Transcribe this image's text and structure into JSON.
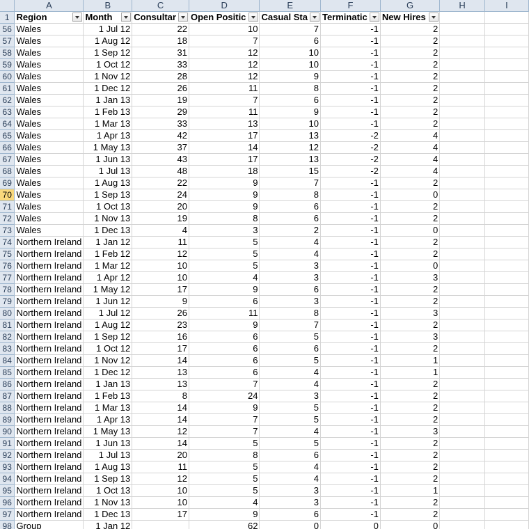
{
  "column_letters": [
    "A",
    "B",
    "C",
    "D",
    "E",
    "F",
    "G",
    "H",
    "I"
  ],
  "header_row": {
    "row_number": "1",
    "cells": [
      "Region",
      "Month",
      "Consultar",
      "Open Positic",
      "Casual Sta",
      "Terminatic",
      "New Hires"
    ]
  },
  "active_row": "70",
  "rows": [
    {
      "n": "56",
      "c": [
        "Wales",
        "1 Jul 12",
        "22",
        "10",
        "7",
        "-1",
        "2"
      ]
    },
    {
      "n": "57",
      "c": [
        "Wales",
        "1 Aug 12",
        "18",
        "7",
        "6",
        "-1",
        "2"
      ]
    },
    {
      "n": "58",
      "c": [
        "Wales",
        "1 Sep 12",
        "31",
        "12",
        "10",
        "-1",
        "2"
      ]
    },
    {
      "n": "59",
      "c": [
        "Wales",
        "1 Oct 12",
        "33",
        "12",
        "10",
        "-1",
        "2"
      ]
    },
    {
      "n": "60",
      "c": [
        "Wales",
        "1 Nov 12",
        "28",
        "12",
        "9",
        "-1",
        "2"
      ]
    },
    {
      "n": "61",
      "c": [
        "Wales",
        "1 Dec 12",
        "26",
        "11",
        "8",
        "-1",
        "2"
      ]
    },
    {
      "n": "62",
      "c": [
        "Wales",
        "1 Jan 13",
        "19",
        "7",
        "6",
        "-1",
        "2"
      ]
    },
    {
      "n": "63",
      "c": [
        "Wales",
        "1 Feb 13",
        "29",
        "11",
        "9",
        "-1",
        "2"
      ]
    },
    {
      "n": "64",
      "c": [
        "Wales",
        "1 Mar 13",
        "33",
        "13",
        "10",
        "-1",
        "2"
      ]
    },
    {
      "n": "65",
      "c": [
        "Wales",
        "1 Apr 13",
        "42",
        "17",
        "13",
        "-2",
        "4"
      ]
    },
    {
      "n": "66",
      "c": [
        "Wales",
        "1 May 13",
        "37",
        "14",
        "12",
        "-2",
        "4"
      ]
    },
    {
      "n": "67",
      "c": [
        "Wales",
        "1 Jun 13",
        "43",
        "17",
        "13",
        "-2",
        "4"
      ]
    },
    {
      "n": "68",
      "c": [
        "Wales",
        "1 Jul 13",
        "48",
        "18",
        "15",
        "-2",
        "4"
      ]
    },
    {
      "n": "69",
      "c": [
        "Wales",
        "1 Aug 13",
        "22",
        "9",
        "7",
        "-1",
        "2"
      ]
    },
    {
      "n": "70",
      "c": [
        "Wales",
        "1 Sep 13",
        "24",
        "9",
        "8",
        "-1",
        "0"
      ]
    },
    {
      "n": "71",
      "c": [
        "Wales",
        "1 Oct 13",
        "20",
        "9",
        "6",
        "-1",
        "2"
      ]
    },
    {
      "n": "72",
      "c": [
        "Wales",
        "1 Nov 13",
        "19",
        "8",
        "6",
        "-1",
        "2"
      ]
    },
    {
      "n": "73",
      "c": [
        "Wales",
        "1 Dec 13",
        "4",
        "3",
        "2",
        "-1",
        "0"
      ]
    },
    {
      "n": "74",
      "c": [
        "Northern Ireland",
        "1 Jan 12",
        "11",
        "5",
        "4",
        "-1",
        "2"
      ]
    },
    {
      "n": "75",
      "c": [
        "Northern Ireland",
        "1 Feb 12",
        "12",
        "5",
        "4",
        "-1",
        "2"
      ]
    },
    {
      "n": "76",
      "c": [
        "Northern Ireland",
        "1 Mar 12",
        "10",
        "5",
        "3",
        "-1",
        "0"
      ]
    },
    {
      "n": "77",
      "c": [
        "Northern Ireland",
        "1 Apr 12",
        "10",
        "4",
        "3",
        "-1",
        "3"
      ]
    },
    {
      "n": "78",
      "c": [
        "Northern Ireland",
        "1 May 12",
        "17",
        "9",
        "6",
        "-1",
        "2"
      ]
    },
    {
      "n": "79",
      "c": [
        "Northern Ireland",
        "1 Jun 12",
        "9",
        "6",
        "3",
        "-1",
        "2"
      ]
    },
    {
      "n": "80",
      "c": [
        "Northern Ireland",
        "1 Jul 12",
        "26",
        "11",
        "8",
        "-1",
        "3"
      ]
    },
    {
      "n": "81",
      "c": [
        "Northern Ireland",
        "1 Aug 12",
        "23",
        "9",
        "7",
        "-1",
        "2"
      ]
    },
    {
      "n": "82",
      "c": [
        "Northern Ireland",
        "1 Sep 12",
        "16",
        "6",
        "5",
        "-1",
        "3"
      ]
    },
    {
      "n": "83",
      "c": [
        "Northern Ireland",
        "1 Oct 12",
        "17",
        "6",
        "6",
        "-1",
        "2"
      ]
    },
    {
      "n": "84",
      "c": [
        "Northern Ireland",
        "1 Nov 12",
        "14",
        "6",
        "5",
        "-1",
        "1"
      ]
    },
    {
      "n": "85",
      "c": [
        "Northern Ireland",
        "1 Dec 12",
        "13",
        "6",
        "4",
        "-1",
        "1"
      ]
    },
    {
      "n": "86",
      "c": [
        "Northern Ireland",
        "1 Jan 13",
        "13",
        "7",
        "4",
        "-1",
        "2"
      ]
    },
    {
      "n": "87",
      "c": [
        "Northern Ireland",
        "1 Feb 13",
        "8",
        "24",
        "3",
        "-1",
        "2"
      ]
    },
    {
      "n": "88",
      "c": [
        "Northern Ireland",
        "1 Mar 13",
        "14",
        "9",
        "5",
        "-1",
        "2"
      ]
    },
    {
      "n": "89",
      "c": [
        "Northern Ireland",
        "1 Apr 13",
        "14",
        "7",
        "5",
        "-1",
        "2"
      ]
    },
    {
      "n": "90",
      "c": [
        "Northern Ireland",
        "1 May 13",
        "12",
        "7",
        "4",
        "-1",
        "3"
      ]
    },
    {
      "n": "91",
      "c": [
        "Northern Ireland",
        "1 Jun 13",
        "14",
        "5",
        "5",
        "-1",
        "2"
      ]
    },
    {
      "n": "92",
      "c": [
        "Northern Ireland",
        "1 Jul 13",
        "20",
        "8",
        "6",
        "-1",
        "2"
      ]
    },
    {
      "n": "93",
      "c": [
        "Northern Ireland",
        "1 Aug 13",
        "11",
        "5",
        "4",
        "-1",
        "2"
      ]
    },
    {
      "n": "94",
      "c": [
        "Northern Ireland",
        "1 Sep 13",
        "12",
        "5",
        "4",
        "-1",
        "2"
      ]
    },
    {
      "n": "95",
      "c": [
        "Northern Ireland",
        "1 Oct 13",
        "10",
        "5",
        "3",
        "-1",
        "1"
      ]
    },
    {
      "n": "96",
      "c": [
        "Northern Ireland",
        "1 Nov 13",
        "10",
        "4",
        "3",
        "-1",
        "2"
      ]
    },
    {
      "n": "97",
      "c": [
        "Northern Ireland",
        "1 Dec 13",
        "17",
        "9",
        "6",
        "-1",
        "2"
      ]
    },
    {
      "n": "98",
      "c": [
        "Group",
        "1 Jan 12",
        "",
        "62",
        "0",
        "0",
        "0"
      ]
    }
  ],
  "colors": {
    "header_bg": "#dfe6ef",
    "header_text": "#2b3f59",
    "active_row_bg": "#f9d87c",
    "gridline": "#d4d4d4"
  }
}
